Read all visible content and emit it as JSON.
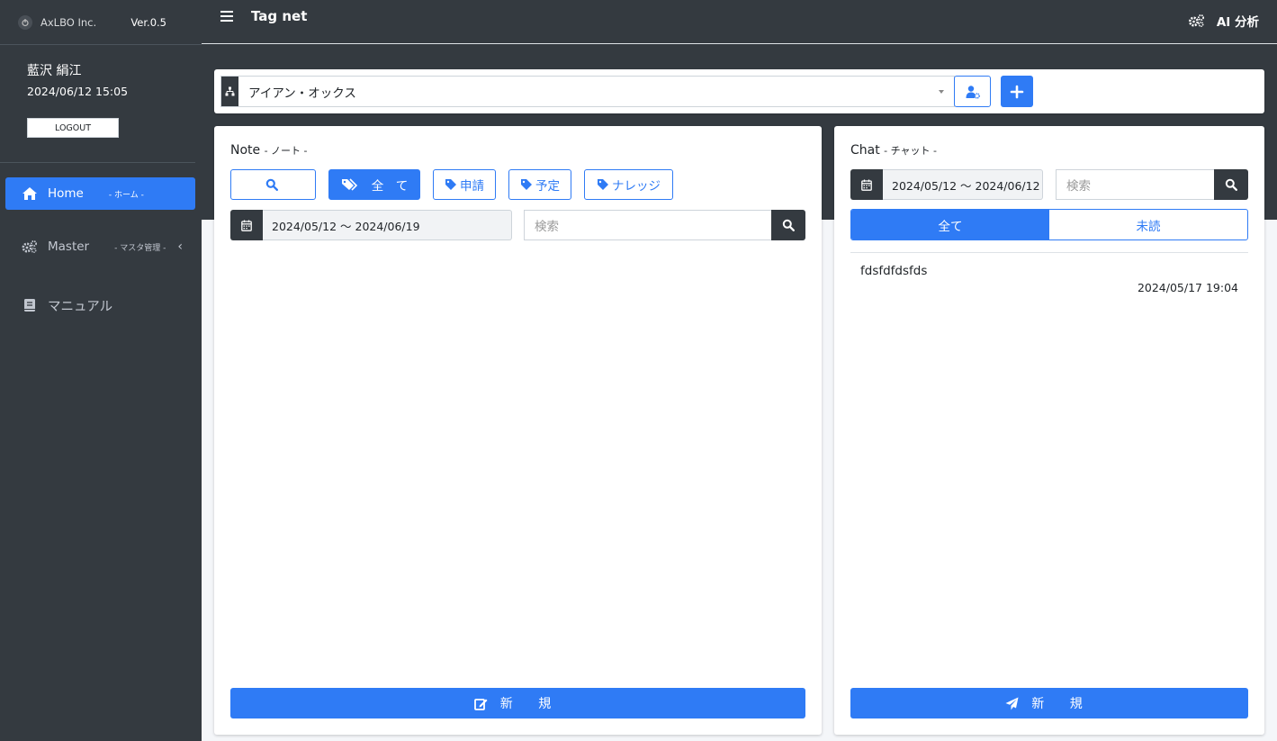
{
  "brand": {
    "name": "AxLBO Inc.",
    "version": "Ver.0.5"
  },
  "user": {
    "name": "藍沢 絹江",
    "datetime": "2024/06/12 15:05",
    "logout_label": "LOGOUT"
  },
  "nav": [
    {
      "label": "Home",
      "sub": "- ホーム -",
      "icon": "home-icon",
      "active": true
    },
    {
      "label": "Master",
      "sub": "- マスタ管理 -",
      "icon": "gears-icon",
      "active": false
    },
    {
      "label": "マニュアル",
      "sub": "",
      "icon": "book-icon",
      "active": false
    }
  ],
  "topbar": {
    "title": "Tag net",
    "ai_label": "AI 分析"
  },
  "group": {
    "selected": "アイアン・オックス"
  },
  "note": {
    "title": "Note",
    "subtitle": "- ノート -",
    "tags": [
      {
        "label": "全　て",
        "active": true
      },
      {
        "label": "申請",
        "active": false
      },
      {
        "label": "予定",
        "active": false
      },
      {
        "label": "ナレッジ",
        "active": false
      }
    ],
    "date_range": "2024/05/12 〜 2024/06/19",
    "search_placeholder": "検索",
    "new_label": "新 規"
  },
  "chat": {
    "title": "Chat",
    "subtitle": "- チャット -",
    "date_range": "2024/05/12 〜 2024/06/12",
    "search_placeholder": "検索",
    "tabs": [
      {
        "label": "全て",
        "active": true
      },
      {
        "label": "未読",
        "active": false
      }
    ],
    "messages": [
      {
        "text": "fdsfdfdsfds",
        "time": "2024/05/17 19:04"
      }
    ],
    "new_label": "新 規"
  },
  "colors": {
    "primary": "#2f7bf5",
    "dark": "#343a40",
    "background": "#f4f6f9"
  }
}
